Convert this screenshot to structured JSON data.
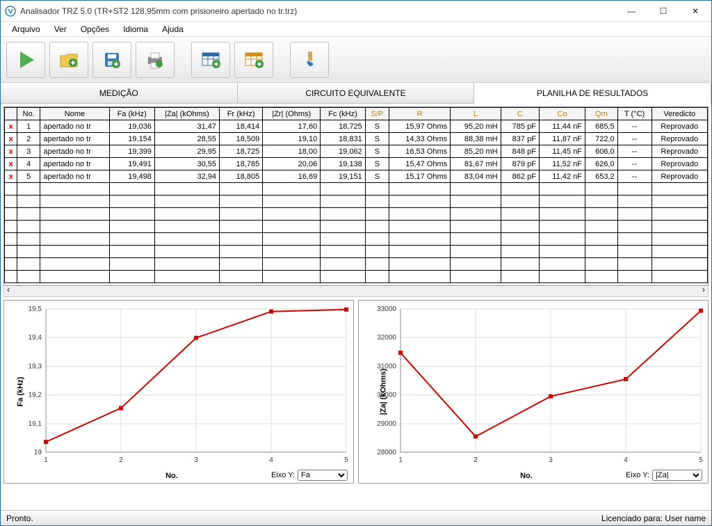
{
  "window": {
    "title": "Analisador TRZ 5.0 (TR+ST2 128,95mm com prisioneiro apertado no tr.trz)"
  },
  "menus": [
    "Arquivo",
    "Ver",
    "Opções",
    "Idioma",
    "Ajuda"
  ],
  "toolbar_icons": [
    "play",
    "folder-open",
    "save",
    "print",
    "table-new",
    "table-import",
    "brush"
  ],
  "tabs": {
    "items": [
      "MEDIÇÃO",
      "CIRCUITO EQUIVALENTE",
      "PLANILHA DE RESULTADOS"
    ],
    "active": 2
  },
  "table": {
    "headers": [
      "",
      "No.",
      "Nome",
      "Fa (kHz)",
      "|Za| (kOhms)",
      "Fr (kHz)",
      "|Zr| (Ohms)",
      "Fc (kHz)",
      "S/P",
      "R",
      "L",
      "C",
      "Co",
      "Qm",
      "T (°C)",
      "Veredicto"
    ],
    "orange_cols": [
      8,
      9,
      10,
      11,
      12,
      13
    ],
    "rows": [
      {
        "no": "1",
        "nome": "apertado no tr",
        "fa": "19,036",
        "za": "31,47",
        "fr": "18,414",
        "zr": "17,60",
        "fc": "18,725",
        "sp": "S",
        "r": "15,97 Ohms",
        "l": "95,20 mH",
        "c": "785 pF",
        "co": "11,44 nF",
        "qm": "685,5",
        "t": "--",
        "ver": "Reprovado"
      },
      {
        "no": "2",
        "nome": "apertado no tr",
        "fa": "19,154",
        "za": "28,55",
        "fr": "18,509",
        "zr": "19,10",
        "fc": "18,831",
        "sp": "S",
        "r": "14,33 Ohms",
        "l": "88,38 mH",
        "c": "837 pF",
        "co": "11,87 nF",
        "qm": "722,0",
        "t": "--",
        "ver": "Reprovado"
      },
      {
        "no": "3",
        "nome": "apertado no tr",
        "fa": "19,399",
        "za": "29,95",
        "fr": "18,725",
        "zr": "18,00",
        "fc": "19,062",
        "sp": "S",
        "r": "16,53 Ohms",
        "l": "85,20 mH",
        "c": "848 pF",
        "co": "11,45 nF",
        "qm": "606,0",
        "t": "--",
        "ver": "Reprovado"
      },
      {
        "no": "4",
        "nome": "apertado no tr",
        "fa": "19,491",
        "za": "30,55",
        "fr": "18,785",
        "zr": "20,06",
        "fc": "19,138",
        "sp": "S",
        "r": "15,47 Ohms",
        "l": "81,67 mH",
        "c": "879 pF",
        "co": "11,52 nF",
        "qm": "626,0",
        "t": "--",
        "ver": "Reprovado"
      },
      {
        "no": "5",
        "nome": "apertado no tr",
        "fa": "19,498",
        "za": "32,94",
        "fr": "18,805",
        "zr": "16,69",
        "fc": "19,151",
        "sp": "S",
        "r": "15,17 Ohms",
        "l": "83,04 mH",
        "c": "862 pF",
        "co": "11,42 nF",
        "qm": "653,2",
        "t": "--",
        "ver": "Reprovado"
      }
    ]
  },
  "chart_data": [
    {
      "type": "line",
      "title": "",
      "xlabel": "No.",
      "ylabel": "Fa (kHz)",
      "x": [
        1,
        2,
        3,
        4,
        5
      ],
      "y": [
        19.036,
        19.154,
        19.399,
        19.491,
        19.498
      ],
      "yticks": [
        19,
        19.1,
        19.2,
        19.3,
        19.4,
        19.5
      ],
      "xlim": [
        1,
        5
      ],
      "ylim": [
        19,
        19.5
      ],
      "ytick_labels": [
        "19",
        "19,1",
        "19,2",
        "19,3",
        "19,4",
        "19,5"
      ],
      "eixo_label": "Eixo Y:",
      "eixo_value": "Fa"
    },
    {
      "type": "line",
      "title": "",
      "xlabel": "No.",
      "ylabel": "|Za| (kOhms)",
      "x": [
        1,
        2,
        3,
        4,
        5
      ],
      "y": [
        31470,
        28550,
        29950,
        30550,
        32940
      ],
      "yticks": [
        28000,
        29000,
        30000,
        31000,
        32000,
        33000
      ],
      "xlim": [
        1,
        5
      ],
      "ylim": [
        28000,
        33000
      ],
      "ytick_labels": [
        "28000",
        "29000",
        "30000",
        "31000",
        "32000",
        "33000"
      ],
      "eixo_label": "Eixo Y:",
      "eixo_value": "|Za|"
    }
  ],
  "status": {
    "left": "Pronto.",
    "right": "Licenciado para: User name"
  },
  "winbtns": {
    "min": "—",
    "max": "☐",
    "close": "✕"
  }
}
